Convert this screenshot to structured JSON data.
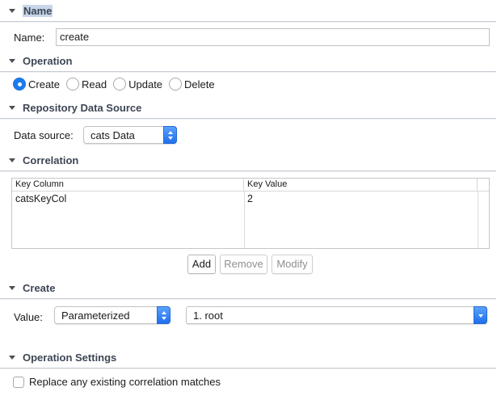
{
  "sections": {
    "name": "Name",
    "operation": "Operation",
    "repository": "Repository Data Source",
    "correlation": "Correlation",
    "create": "Create",
    "operation_settings": "Operation Settings"
  },
  "name_field": {
    "label": "Name:",
    "value": "create"
  },
  "operation": {
    "options": [
      "Create",
      "Read",
      "Update",
      "Delete"
    ],
    "selected": "Create"
  },
  "data_source": {
    "label": "Data source:",
    "value": "cats Data"
  },
  "correlation_table": {
    "columns": [
      "Key Column",
      "Key Value"
    ],
    "rows": [
      [
        "catsKeyCol",
        "2"
      ]
    ]
  },
  "buttons": {
    "add": "Add",
    "remove": "Remove",
    "modify": "Modify"
  },
  "create": {
    "label": "Value:",
    "mode": "Parameterized",
    "param": "1. root"
  },
  "settings": {
    "replace_label": "Replace any existing correlation matches"
  },
  "colors": {
    "accent": "#1c7bf0",
    "header_text": "#3d4654"
  }
}
